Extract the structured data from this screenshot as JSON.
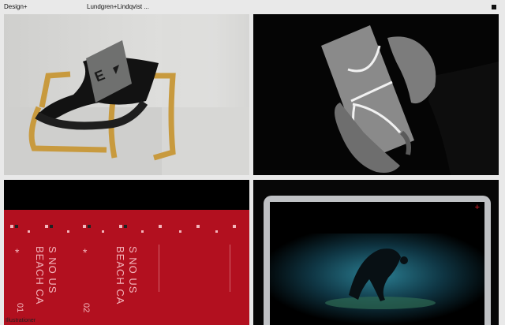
{
  "header": {
    "brand": "Design+",
    "title": "Lundgren+Lindqvist ..."
  },
  "tiles": [
    {
      "name": "chair-stationery",
      "alt": ""
    },
    {
      "name": "hands-holding-brochure",
      "alt": ""
    },
    {
      "name": "red-poster",
      "poster": {
        "columns": [
          "S NO US",
          "BEACH CA",
          "S NO US",
          "BEACH CA"
        ],
        "numbers": [
          "01",
          "02"
        ],
        "caption": "Illustrationer"
      }
    },
    {
      "name": "laptop-website",
      "icon": "plus-icon"
    }
  ],
  "colors": {
    "poster_red": "#b2101f",
    "accent_red": "#e1242b",
    "background": "#e9e9e9"
  }
}
